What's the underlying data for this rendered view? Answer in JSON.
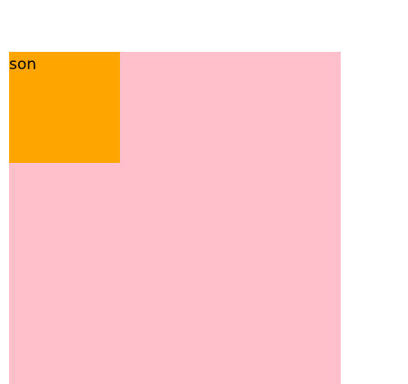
{
  "colors": {
    "background": "#ffffff",
    "parent_box": "#ffc0cb",
    "son_box": "#ffa500"
  },
  "son": {
    "label": "son"
  }
}
